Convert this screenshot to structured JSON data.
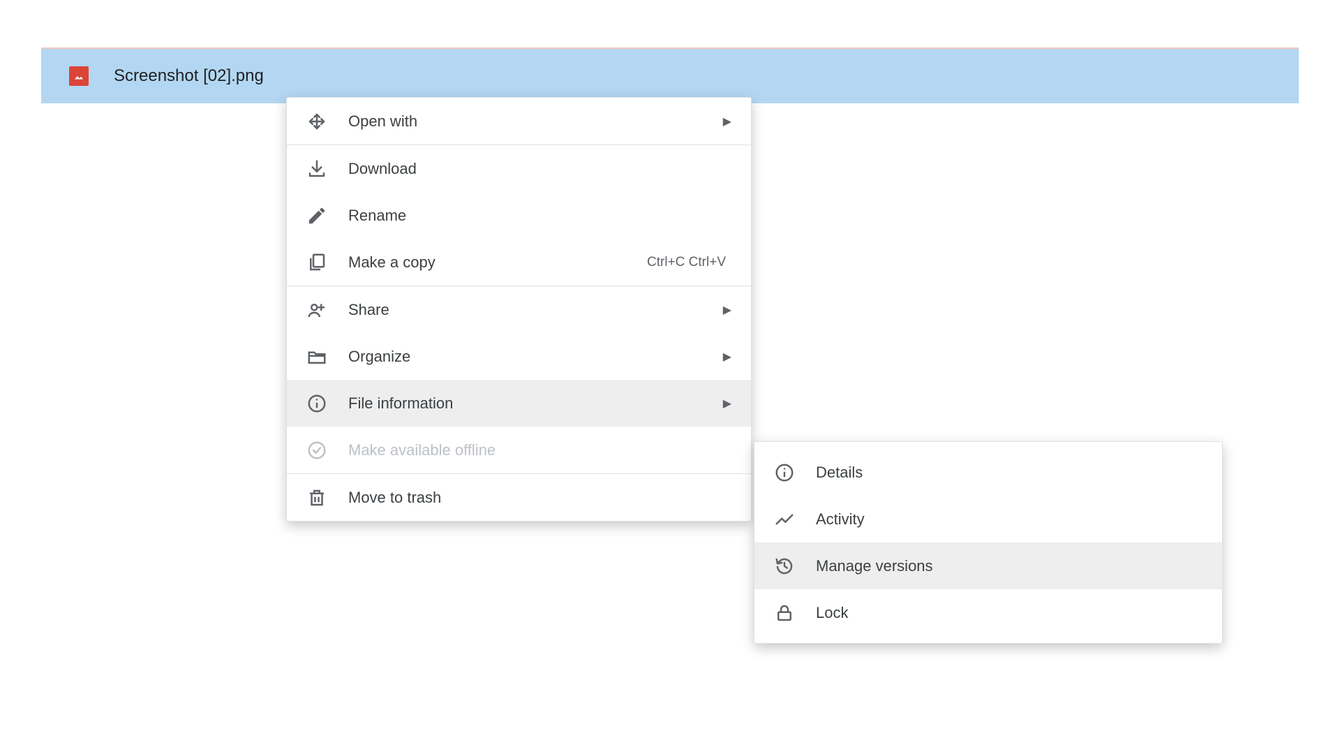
{
  "file": {
    "name": "Screenshot [02].png"
  },
  "context_menu": {
    "open_with": "Open with",
    "download": "Download",
    "rename": "Rename",
    "make_copy": "Make a copy",
    "make_copy_shortcut": "Ctrl+C Ctrl+V",
    "share": "Share",
    "organize": "Organize",
    "file_information": "File information",
    "make_available_offline": "Make available offline",
    "move_to_trash": "Move to trash"
  },
  "file_info_submenu": {
    "details": "Details",
    "activity": "Activity",
    "manage_versions": "Manage versions",
    "lock": "Lock"
  }
}
